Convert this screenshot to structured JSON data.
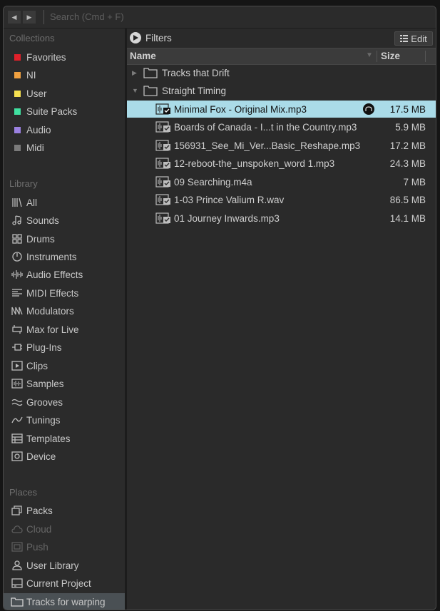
{
  "topbar": {
    "back_icon": "chevron-left-icon",
    "forward_icon": "chevron-right-icon",
    "search_placeholder": "Search (Cmd + F)"
  },
  "sidebar": {
    "collections_title": "Collections",
    "collections": [
      {
        "label": "Favorites",
        "color": "#e0202a"
      },
      {
        "label": "NI",
        "color": "#f0a040"
      },
      {
        "label": "User",
        "color": "#f5e050"
      },
      {
        "label": "Suite Packs",
        "color": "#40e0a0"
      },
      {
        "label": "Audio",
        "color": "#9a80e0"
      },
      {
        "label": "Midi",
        "color": "#7a7a7a"
      }
    ],
    "library_title": "Library",
    "library": [
      {
        "label": "All",
        "icon": "library-bars-icon"
      },
      {
        "label": "Sounds",
        "icon": "music-note-icon"
      },
      {
        "label": "Drums",
        "icon": "drum-grid-icon"
      },
      {
        "label": "Instruments",
        "icon": "instrument-dial-icon"
      },
      {
        "label": "Audio Effects",
        "icon": "audio-waveform-icon"
      },
      {
        "label": "MIDI Effects",
        "icon": "midi-effects-icon"
      },
      {
        "label": "Modulators",
        "icon": "modulator-wave-icon"
      },
      {
        "label": "Max for Live",
        "icon": "max-patch-icon"
      },
      {
        "label": "Plug-Ins",
        "icon": "plugin-connector-icon"
      },
      {
        "label": "Clips",
        "icon": "clip-play-icon"
      },
      {
        "label": "Samples",
        "icon": "sample-waveform-icon"
      },
      {
        "label": "Grooves",
        "icon": "groove-wave-icon"
      },
      {
        "label": "Tunings",
        "icon": "tuning-curve-icon"
      },
      {
        "label": "Templates",
        "icon": "template-icon"
      },
      {
        "label": "Device",
        "icon": "device-icon"
      }
    ],
    "places_title": "Places",
    "places": [
      {
        "label": "Packs",
        "icon": "packs-icon",
        "dim": false
      },
      {
        "label": "Cloud",
        "icon": "cloud-icon",
        "dim": true
      },
      {
        "label": "Push",
        "icon": "push-icon",
        "dim": true
      },
      {
        "label": "User Library",
        "icon": "user-library-icon",
        "dim": false
      },
      {
        "label": "Current Project",
        "icon": "project-icon",
        "dim": false
      },
      {
        "label": "Tracks for warping",
        "icon": "folder-icon",
        "dim": false
      }
    ]
  },
  "main": {
    "filters_label": "Filters",
    "edit_label": "Edit",
    "col_name": "Name",
    "col_size": "Size",
    "rows": [
      {
        "type": "folder",
        "label": "Tracks that Drift",
        "expanded": false
      },
      {
        "type": "folder",
        "label": "Straight Timing",
        "expanded": true
      },
      {
        "type": "file",
        "label": "Minimal Fox - Original Mix.mp3",
        "size": "17.5 MB",
        "selected": true
      },
      {
        "type": "file",
        "label": "Boards of Canada - I...t in the Country.mp3",
        "size": "5.9 MB"
      },
      {
        "type": "file",
        "label": "156931_See_Mi_Ver...Basic_Reshape.mp3",
        "size": "17.2 MB"
      },
      {
        "type": "file",
        "label": "12-reboot-the_unspoken_word 1.mp3",
        "size": "24.3 MB"
      },
      {
        "type": "file",
        "label": "09 Searching.m4a",
        "size": "7 MB"
      },
      {
        "type": "file",
        "label": "1-03 Prince Valium R.wav",
        "size": "86.5 MB"
      },
      {
        "type": "file",
        "label": "01 Journey Inwards.mp3",
        "size": "14.1 MB"
      }
    ]
  }
}
